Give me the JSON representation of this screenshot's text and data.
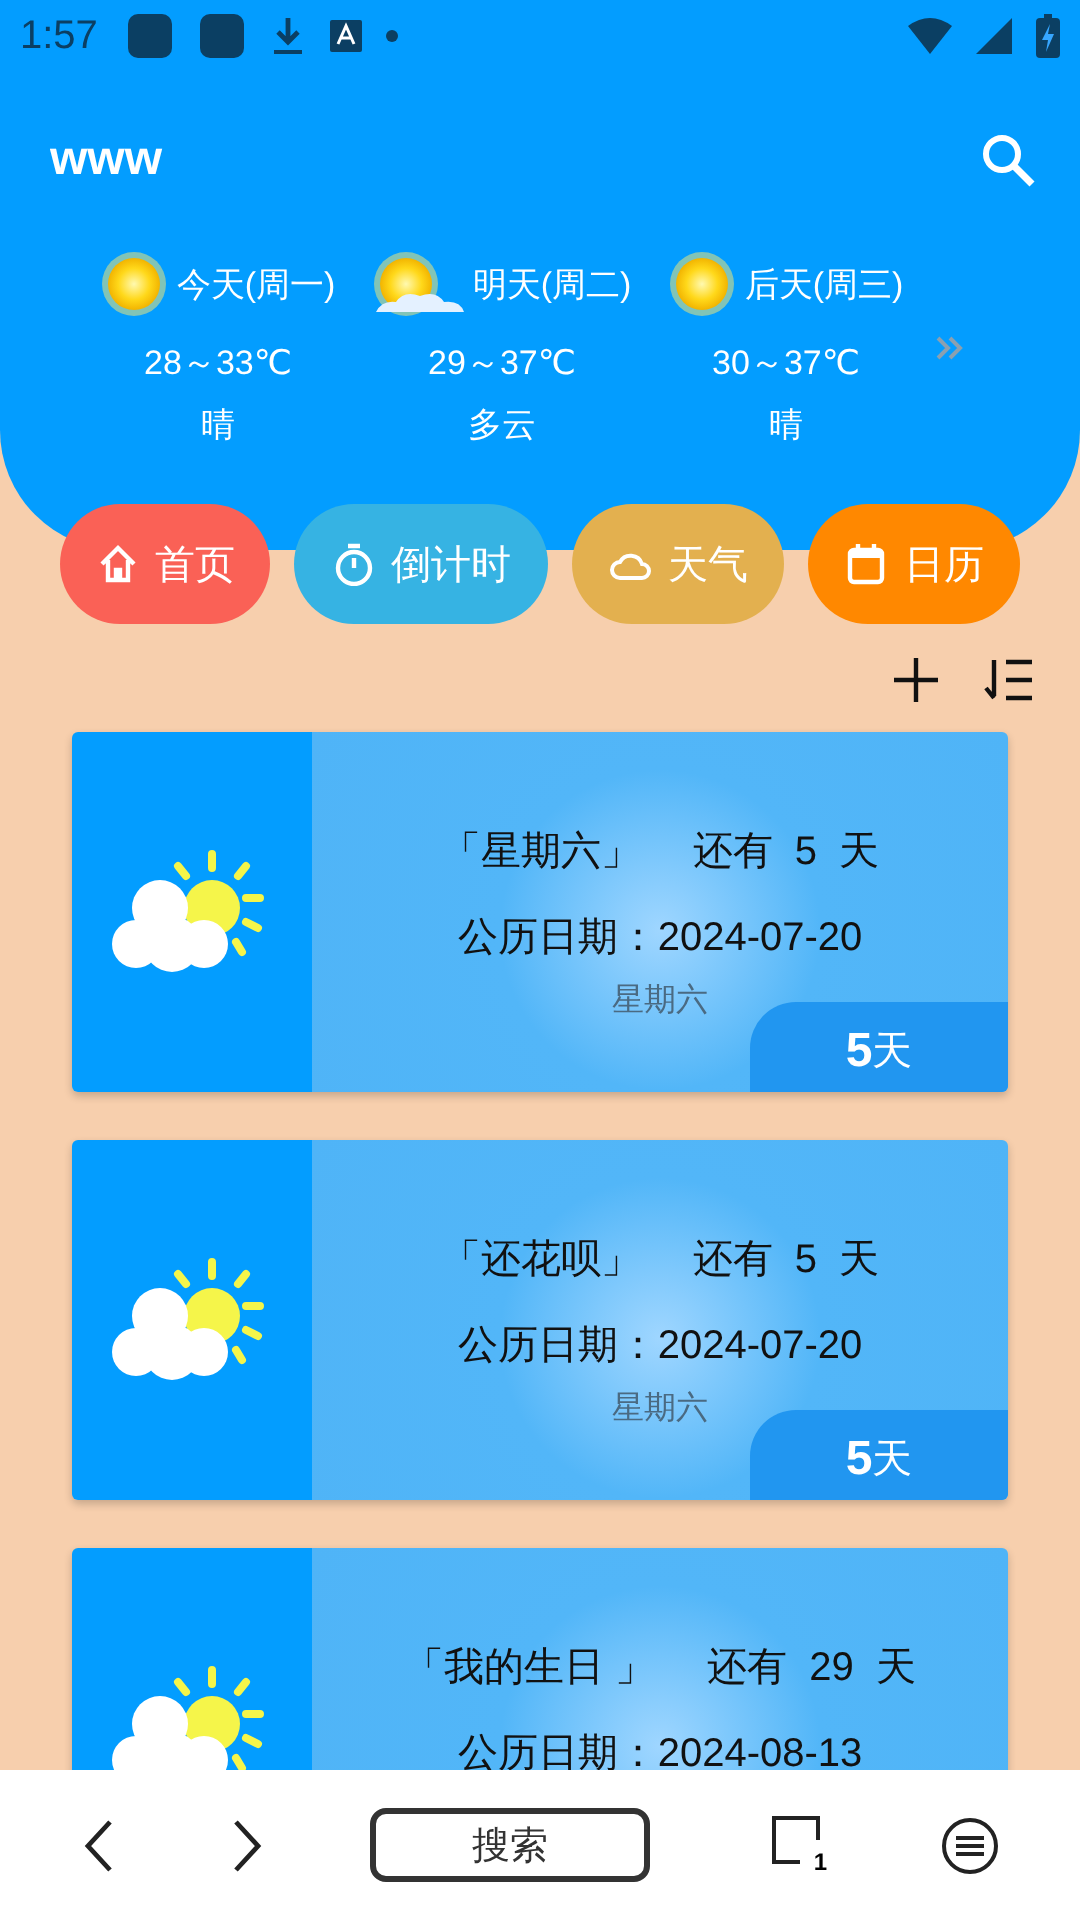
{
  "status_bar": {
    "time": "1:57"
  },
  "app_bar": {
    "title": "www"
  },
  "forecast": [
    {
      "kind": "sunny",
      "day": "今天(周一)",
      "temp": "28～33℃",
      "condition": "晴"
    },
    {
      "kind": "cloudy",
      "day": "明天(周二)",
      "temp": "29～37℃",
      "condition": "多云"
    },
    {
      "kind": "sunny",
      "day": "后天(周三)",
      "temp": "30～37℃",
      "condition": "晴"
    }
  ],
  "nav": [
    {
      "kind": "home",
      "label": "首页",
      "color": "#fa6156"
    },
    {
      "kind": "timer",
      "label": "倒计时",
      "color": "#36b3e3"
    },
    {
      "kind": "cloud",
      "label": "天气",
      "color": "#e3b04f"
    },
    {
      "kind": "calendar",
      "label": "日历",
      "color": "#ff8800"
    }
  ],
  "events": [
    {
      "title": "「星期六」",
      "remaining": "还有  5  天",
      "date": "公历日期：2024-07-20",
      "weekday": "星期六",
      "badge": "**5**天"
    },
    {
      "title": "「还花呗」",
      "remaining": "还有  5  天",
      "date": "公历日期：2024-07-20",
      "weekday": "星期六",
      "badge": "**5**天"
    },
    {
      "title": "「我的生日 」",
      "remaining": "还有  29  天",
      "date": "公历日期：2024-08-13"
    }
  ],
  "bottom_bar": {
    "search": "搜索",
    "tab_count": "1"
  }
}
